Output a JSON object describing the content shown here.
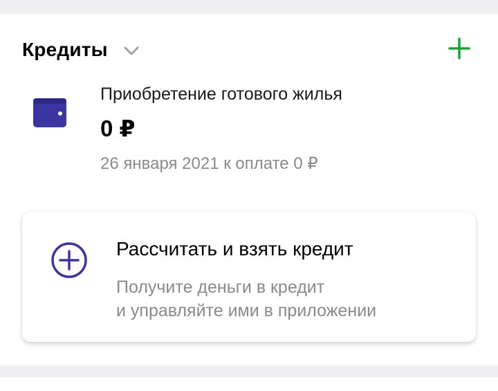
{
  "colors": {
    "accent_green": "#21a038",
    "icon_indigo": "#3a35a0",
    "muted_text": "#8a8a8e"
  },
  "header": {
    "title": "Кредиты",
    "chevron_icon": "chevron-down-icon",
    "add_icon": "plus-icon"
  },
  "loan": {
    "icon": "wallet-icon",
    "name": "Приобретение готового жилья",
    "amount": "0 ₽",
    "due": "26 января 2021 к оплате 0 ₽"
  },
  "promo": {
    "icon": "plus-circle-icon",
    "title": "Рассчитать и взять кредит",
    "line1": "Получите деньги в кредит",
    "line2": "и управляйте ими в приложении"
  }
}
